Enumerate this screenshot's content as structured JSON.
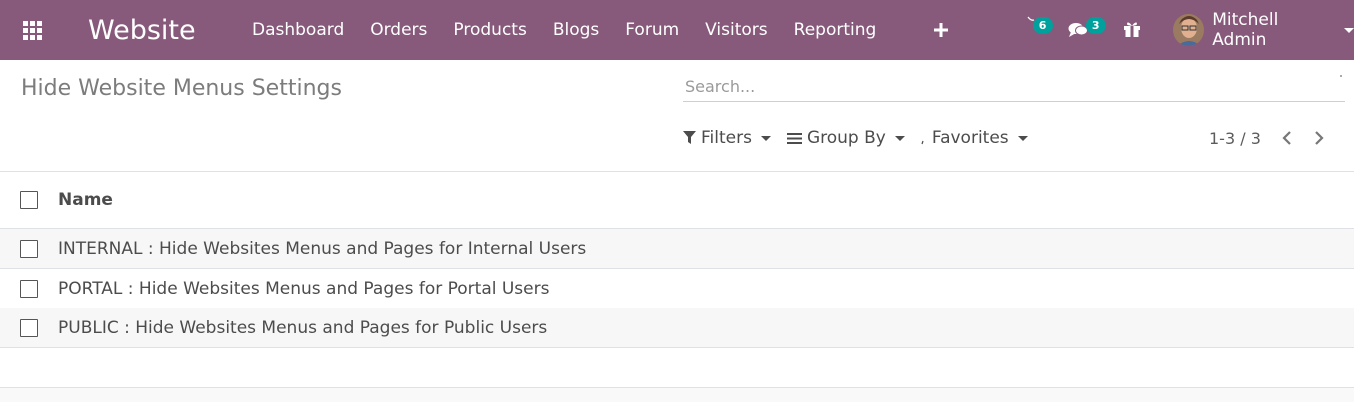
{
  "navbar": {
    "app_title": "Website",
    "menu": [
      {
        "label": "Dashboard"
      },
      {
        "label": "Orders"
      },
      {
        "label": "Products"
      },
      {
        "label": "Blogs"
      },
      {
        "label": "Forum"
      },
      {
        "label": "Visitors"
      },
      {
        "label": "Reporting"
      }
    ],
    "activity_count": "6",
    "messages_count": "3",
    "user_name": "Mitchell Admin",
    "background_color": "#875a7b",
    "badge_color": "#00a09d"
  },
  "control_panel": {
    "title": "Hide Website Menus Settings",
    "search_placeholder": "Search...",
    "filters_label": "Filters",
    "group_by_label": "Group By",
    "favorites_label": "Favorites",
    "pager_value": "1-3 / 3"
  },
  "list": {
    "column_name": "Name",
    "rows": [
      {
        "name": "INTERNAL : Hide Websites Menus and Pages for Internal Users"
      },
      {
        "name": "PORTAL : Hide Websites Menus and Pages for Portal Users"
      },
      {
        "name": "PUBLIC : Hide Websites Menus and Pages for Public Users"
      }
    ]
  },
  "icons": {
    "apps": "apps-grid-icon",
    "plus": "plus-icon",
    "activity": "clock-icon",
    "messages": "chat-icon",
    "gift": "gift-icon",
    "filter": "filter-icon",
    "group_by": "bars-icon",
    "favorites": "star-icon",
    "pager_prev": "chevron-left-icon",
    "pager_next": "chevron-right-icon"
  }
}
